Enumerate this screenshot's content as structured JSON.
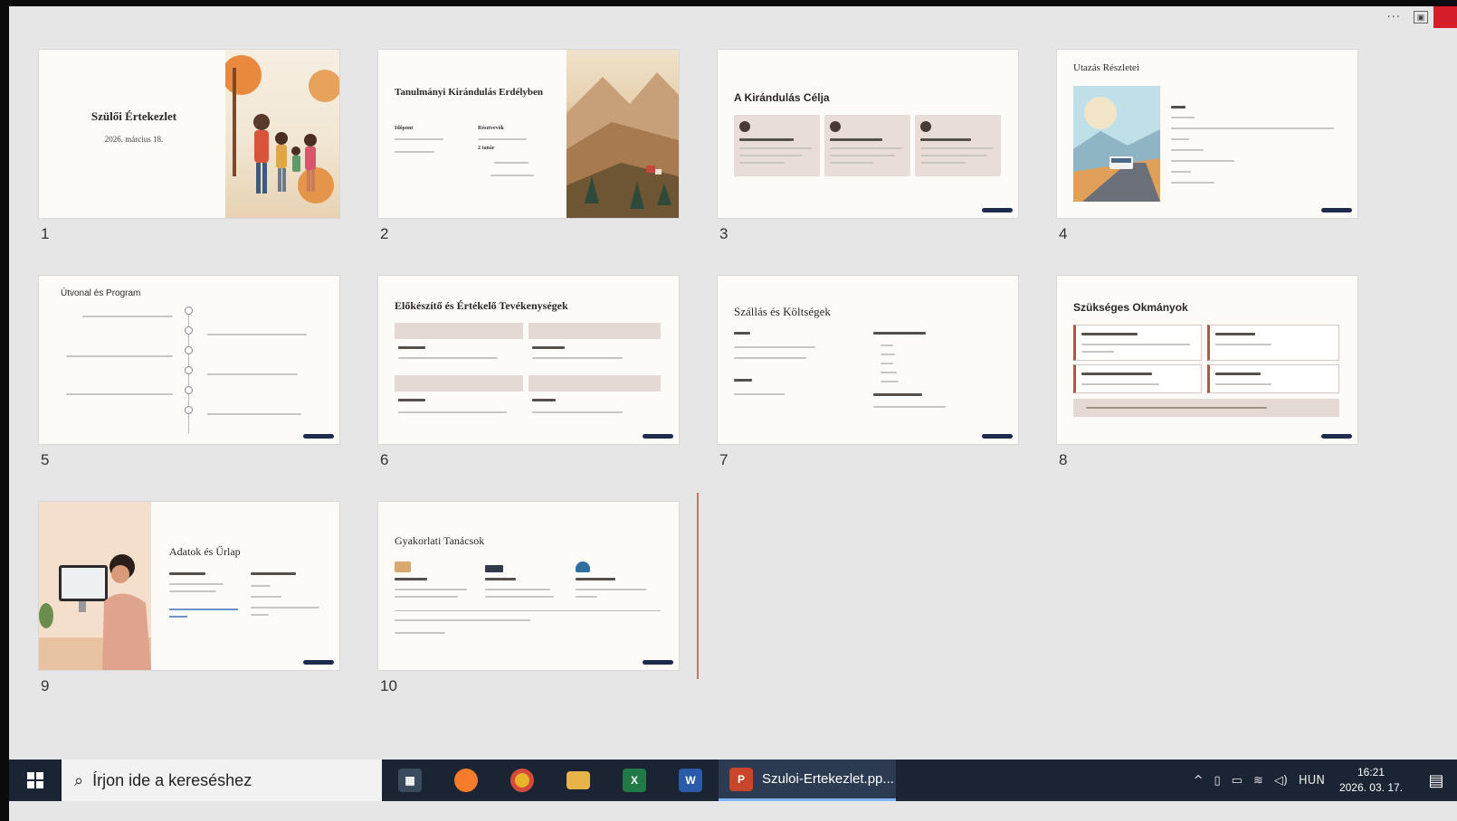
{
  "slides": [
    {
      "number": "1",
      "title": "Szülői Értekezlet",
      "subtitle": "2026. március 18."
    },
    {
      "number": "2",
      "title": "Tanulmányi Kirándulás Erdélyben",
      "col1_heading": "Időpont",
      "col2_heading": "Résztvevők",
      "col2_extra": "2 tanár"
    },
    {
      "number": "3",
      "title": "A Kirándulás Célja"
    },
    {
      "number": "4",
      "title": "Utazás Részletei"
    },
    {
      "number": "5",
      "title": "Útvonal és Program"
    },
    {
      "number": "6",
      "title": "Előkészítő és Értékelő Tevékenységek"
    },
    {
      "number": "7",
      "title": "Szállás és Költségek"
    },
    {
      "number": "8",
      "title": "Szükséges Okmányok"
    },
    {
      "number": "9",
      "title": "Adatok és Űrlap"
    },
    {
      "number": "10",
      "title": "Gyakorlati Tanácsok"
    }
  ],
  "window": {
    "more_label": "···"
  },
  "taskbar": {
    "search_placeholder": "Írjon ide a kereséshez",
    "active_window_label": "Szuloi-Ertekezlet.pp...",
    "language": "HUN",
    "time": "16:21",
    "date": "2026. 03. 17."
  },
  "colors": {
    "taskbar_bg": "#1b2433",
    "accent_red": "#d61e2b",
    "slide_pill": "#1d2b4e",
    "drop_marker": "#c8735a"
  }
}
